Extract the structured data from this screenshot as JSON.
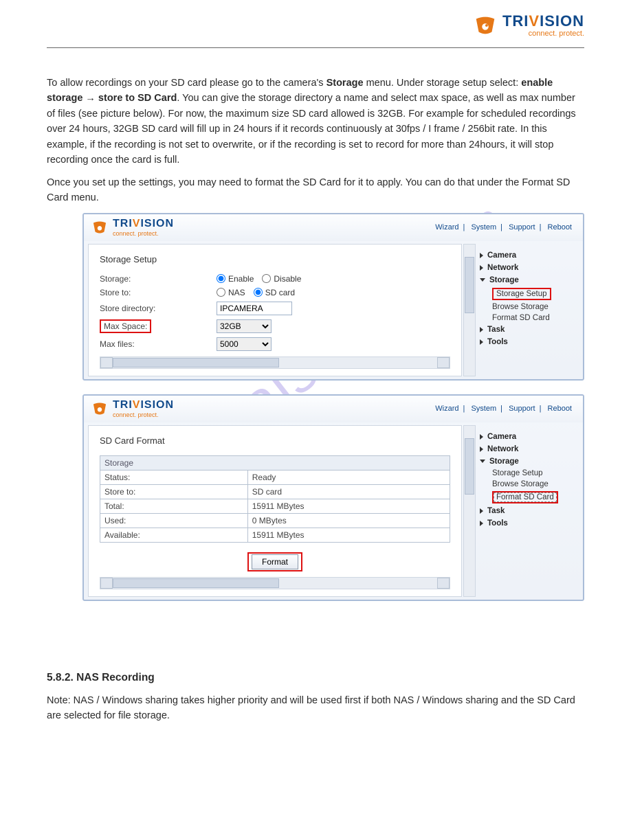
{
  "header": {
    "brand_a": "TRI",
    "brand_b": "V",
    "brand_c": "ISION",
    "tagline": "connect. protect."
  },
  "doc": {
    "p1a": "To allow recordings on your SD card please go to the camera's ",
    "p1b": "Storage",
    "p1c": " menu. Under storage setup select: ",
    "p1d": "enable storage → store to SD Card",
    "p1e": ". You can give the storage directory a name and select max space, as well as max number of files (see picture below). For now, the maximum size SD card allowed is 32GB.  For example for scheduled recordings over 24 hours, 32GB SD card will fill up in 24 hours if it records continuously at 30fps / I frame / 256bit rate.  In this example, if the recording is not set to overwrite, or if the recording is set to record for more than 24hours, it will stop recording once the card is full.",
    "p2": "Once you set up the settings, you may need to format the SD Card for it to apply. You can do that under the Format SD Card menu.",
    "sec_head": "5.8.2. NAS Recording",
    "p3": "Note: NAS / Windows sharing takes higher priority and will be used first if both NAS / Windows sharing and the SD Card are selected for file storage."
  },
  "watermark": "manualshive.com",
  "toplinks": {
    "wizard": "Wizard",
    "system": "System",
    "support": "Support",
    "reboot": "Reboot"
  },
  "nav": {
    "camera": "Camera",
    "network": "Network",
    "storage": "Storage",
    "storage_setup": "Storage Setup",
    "browse_storage": "Browse Storage",
    "format_sd": "Format SD Card",
    "task": "Task",
    "tools": "Tools"
  },
  "panel1": {
    "title": "Storage Setup",
    "storage_label": "Storage:",
    "storeto_label": "Store to:",
    "dir_label": "Store directory:",
    "maxspace_label": "Max Space:",
    "maxfiles_label": "Max files:",
    "enable": "Enable",
    "disable": "Disable",
    "nas": "NAS",
    "sdcard": "SD card",
    "dir_value": "IPCAMERA",
    "maxspace_value": "32GB",
    "maxfiles_value": "5000"
  },
  "panel2": {
    "title": "SD Card Format",
    "th": "Storage",
    "status_l": "Status:",
    "status_v": "Ready",
    "storeto_l": "Store to:",
    "storeto_v": "SD card",
    "total_l": "Total:",
    "total_v": "15911 MBytes",
    "used_l": "Used:",
    "used_v": "0 MBytes",
    "avail_l": "Available:",
    "avail_v": "15911 MBytes",
    "format_btn": "Format"
  }
}
